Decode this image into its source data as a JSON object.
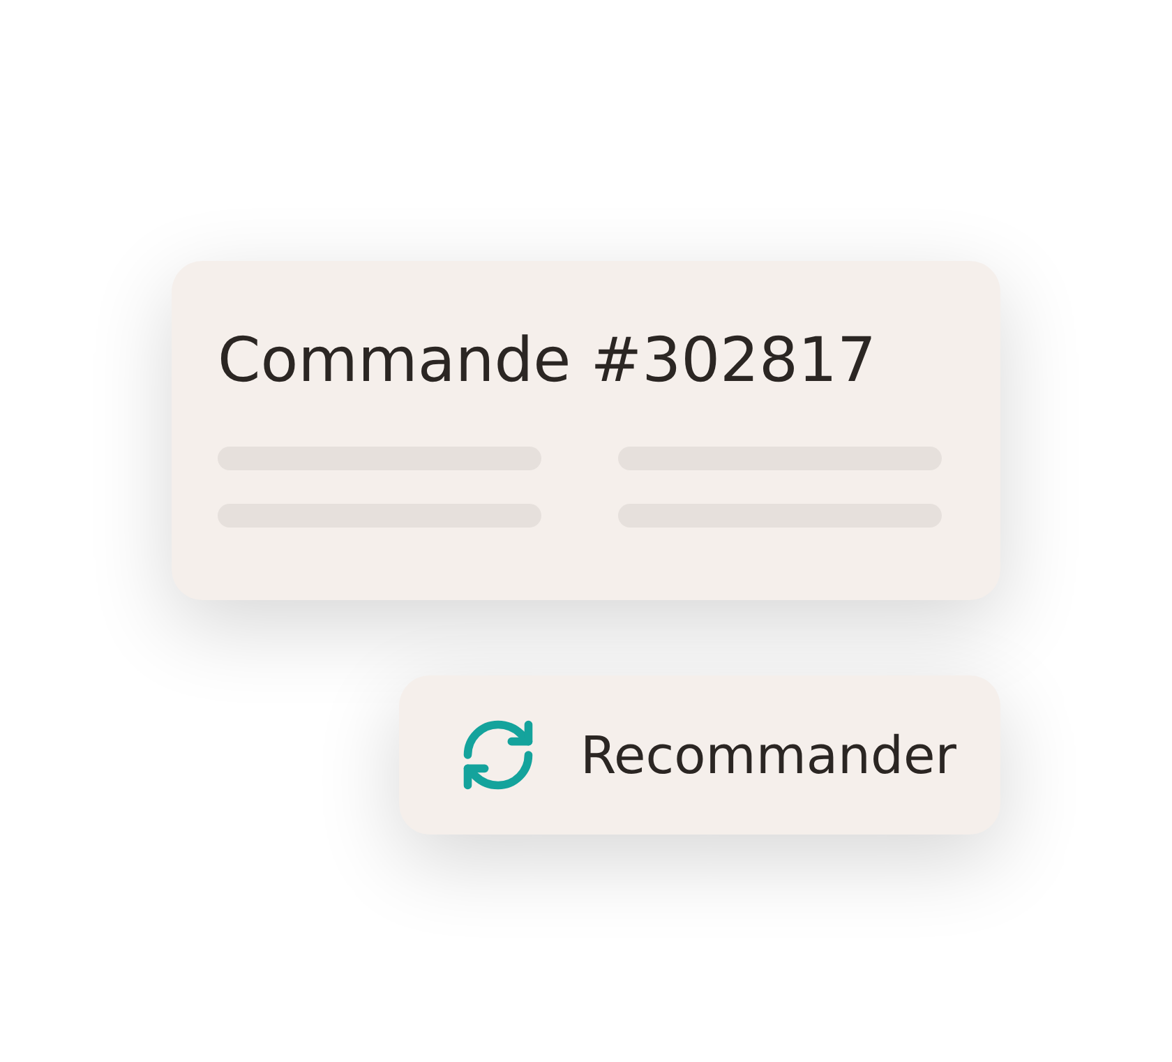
{
  "order_card": {
    "title": "Commande #302817"
  },
  "reorder_button": {
    "label": "Recommander"
  }
}
